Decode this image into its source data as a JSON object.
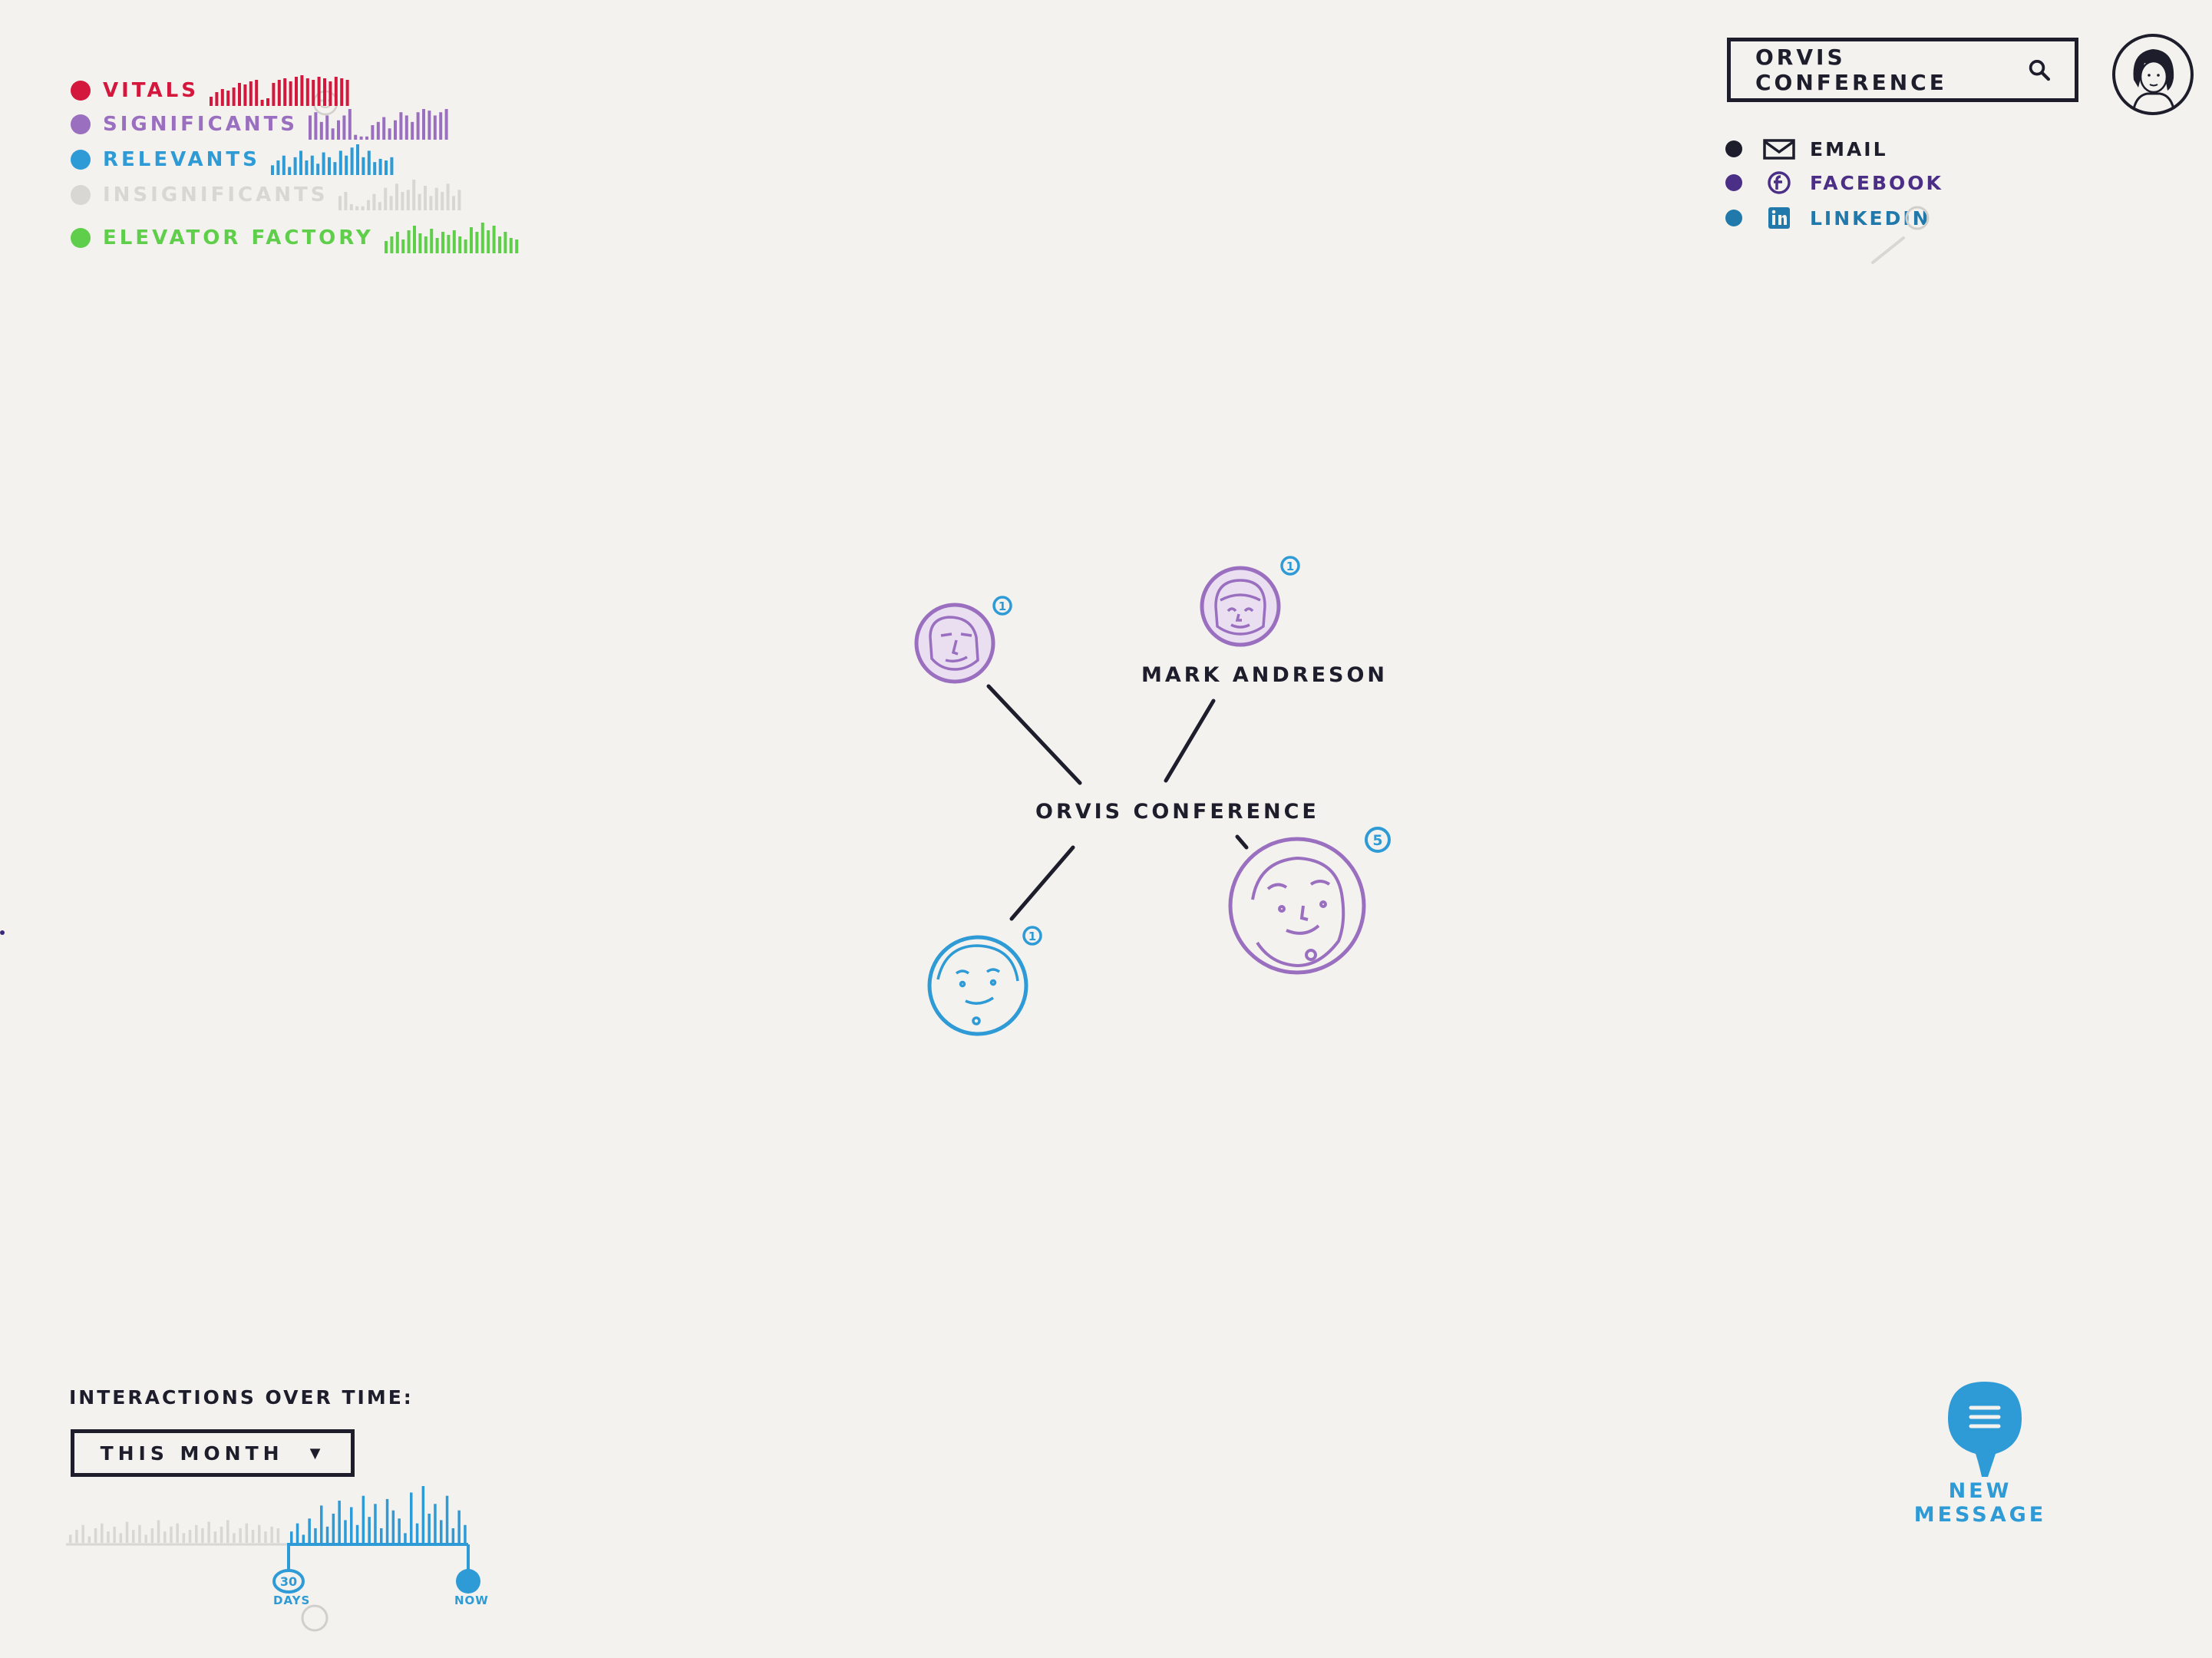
{
  "colors": {
    "vital": "#d4173c",
    "significant": "#9a6fc0",
    "relevant": "#2e9ad6",
    "insignificant": "#d8d7d3",
    "elevator": "#5fcf4b",
    "ink": "#1d1d2b",
    "facebook": "#4b2e86",
    "linkedin": "#2178ab",
    "background": "#f3f2ee"
  },
  "legend": {
    "items": [
      {
        "label": "VITALS",
        "color": "#d4173c",
        "bars": [
          12,
          18,
          22,
          20,
          24,
          30,
          28,
          32,
          34,
          8,
          10,
          30,
          34,
          36,
          32,
          38,
          40,
          36,
          34,
          38,
          36,
          32,
          38,
          36,
          34
        ]
      },
      {
        "label": "SIGNIFICANTS",
        "color": "#9a6fc0",
        "bars": [
          30,
          34,
          22,
          30,
          14,
          24,
          30,
          38,
          6,
          4,
          4,
          18,
          22,
          28,
          14,
          24,
          34,
          30,
          22,
          34,
          38,
          36,
          30,
          34,
          38
        ]
      },
      {
        "label": "RELEVANTS",
        "color": "#2e9ad6",
        "bars": [
          12,
          18,
          24,
          10,
          22,
          30,
          18,
          24,
          14,
          28,
          22,
          16,
          30,
          24,
          34,
          38,
          22,
          30,
          16,
          20,
          18,
          22
        ]
      },
      {
        "label": "INSIGNIFICANTS",
        "color": "#d8d7d3",
        "bars": [
          14,
          18,
          6,
          4,
          4,
          10,
          16,
          8,
          22,
          14,
          26,
          18,
          20,
          30,
          16,
          24,
          14,
          22,
          18,
          26,
          14,
          20
        ]
      },
      {
        "label": "ELEVATOR FACTORY",
        "color": "#5fcf4b",
        "bars": [
          16,
          22,
          28,
          18,
          30,
          36,
          26,
          22,
          32,
          20,
          28,
          24,
          30,
          22,
          18,
          34,
          28,
          40,
          30,
          36,
          22,
          28,
          20,
          18
        ]
      }
    ]
  },
  "search": {
    "value": "ORVIS CONFERENCE"
  },
  "channels": [
    {
      "label": "EMAIL",
      "icon": "envelope-icon",
      "color": "#1d1d2b"
    },
    {
      "label": "FACEBOOK",
      "icon": "facebook-icon",
      "color": "#4b2e86"
    },
    {
      "label": "LINKEDIN",
      "icon": "linkedin-icon",
      "color": "#2178ab"
    }
  ],
  "graph": {
    "center_label": "ORVIS CONFERENCE",
    "contacts": [
      {
        "name": "",
        "badge": "1",
        "category": "significant"
      },
      {
        "name": "MARK ANDRESON",
        "badge": "1",
        "category": "significant"
      },
      {
        "name": "",
        "badge": "5",
        "category": "significant"
      },
      {
        "name": "",
        "badge": "1",
        "category": "relevant"
      }
    ]
  },
  "timeline": {
    "title": "INTERACTIONS OVER TIME:",
    "period": "THIS MONTH",
    "range_start_value": "30",
    "range_start_unit": "DAYS",
    "range_end_label": "NOW",
    "bars_past": [
      10,
      16,
      22,
      8,
      18,
      24,
      14,
      20,
      12,
      26,
      16,
      22,
      10,
      18,
      28,
      14,
      20,
      24,
      12,
      16,
      22,
      18,
      26,
      14,
      20,
      28,
      12,
      18,
      24,
      16,
      22,
      14,
      20,
      18
    ],
    "bars_recent": [
      14,
      24,
      10,
      30,
      18,
      46,
      20,
      36,
      52,
      28,
      44,
      22,
      58,
      32,
      48,
      18,
      54,
      40,
      30,
      12,
      62,
      24,
      70,
      36,
      48,
      28,
      58,
      18,
      40,
      22
    ]
  },
  "new_message": {
    "label": "NEW MESSAGE",
    "icon": "hamburger-icon"
  }
}
